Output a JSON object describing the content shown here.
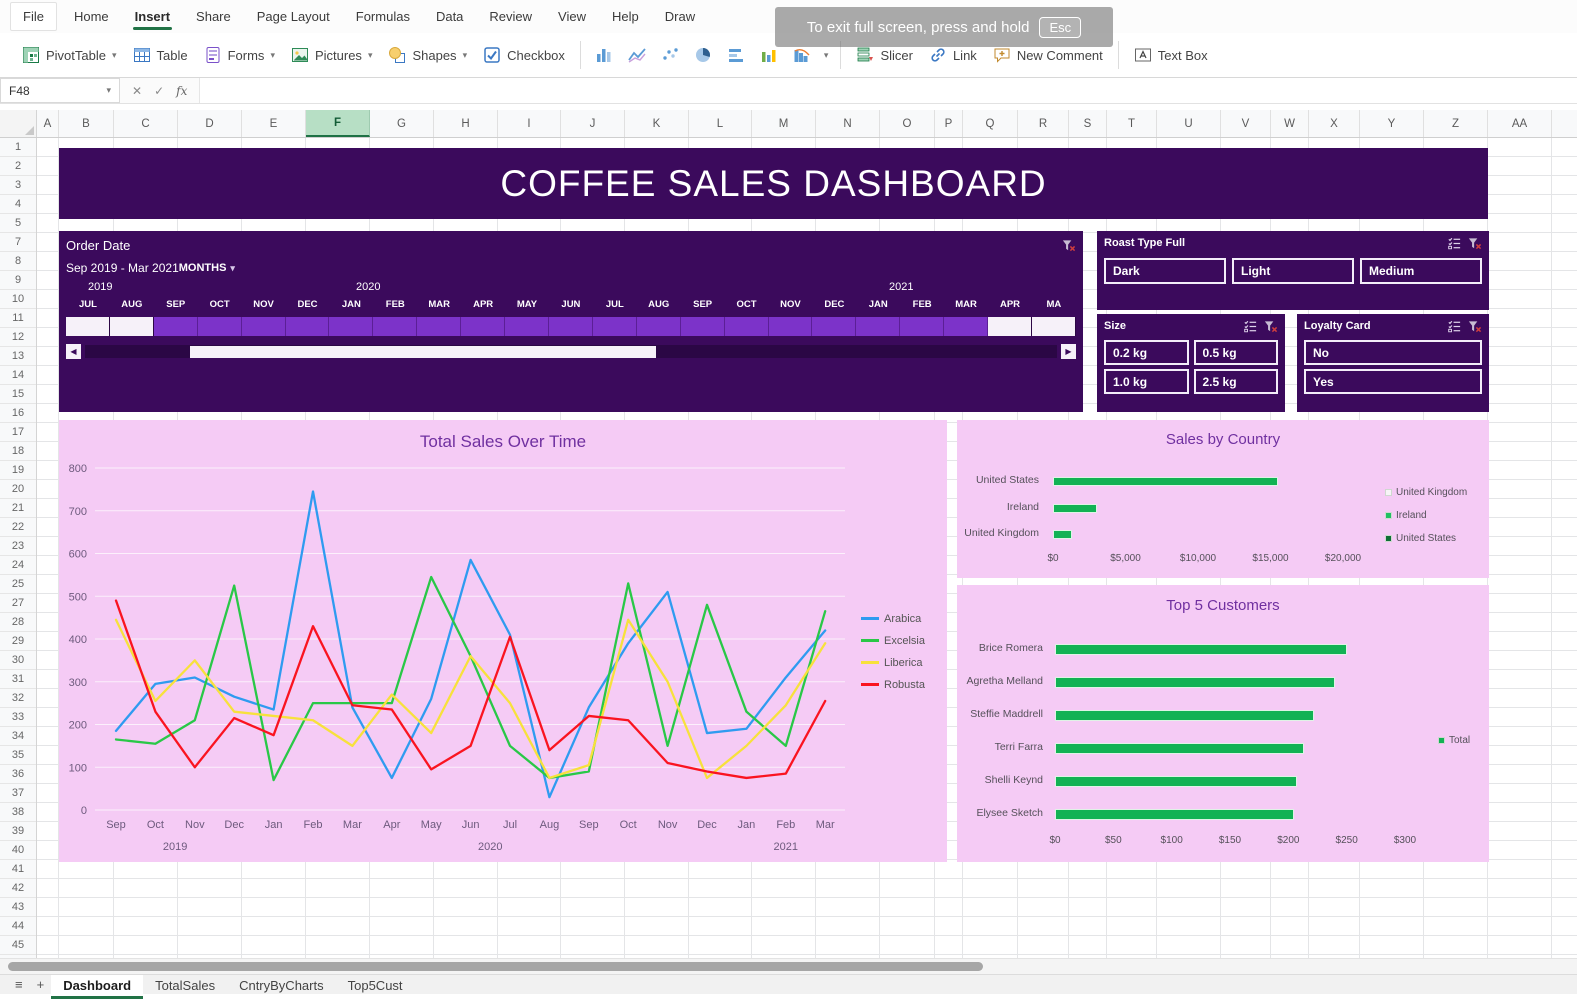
{
  "menu": {
    "tabs": [
      "File",
      "Home",
      "Insert",
      "Share",
      "Page Layout",
      "Formulas",
      "Data",
      "Review",
      "View",
      "Help",
      "Draw"
    ],
    "active": "Insert"
  },
  "overlay": {
    "text": "To exit full screen, press and hold",
    "key": "Esc"
  },
  "ribbon": {
    "items": [
      {
        "label": "PivotTable",
        "icon": "pivottable-icon",
        "caret": true
      },
      {
        "label": "Table",
        "icon": "table-icon",
        "caret": false
      },
      {
        "label": "Forms",
        "icon": "forms-icon",
        "caret": true
      },
      {
        "label": "Pictures",
        "icon": "pictures-icon",
        "caret": true
      },
      {
        "label": "Shapes",
        "icon": "shapes-icon",
        "caret": true
      },
      {
        "label": "Checkbox",
        "icon": "checkbox-icon",
        "caret": false
      }
    ],
    "chart_buttons": [
      "column-chart-icon",
      "line-chart-icon",
      "scatter-chart-icon",
      "pie-chart-icon",
      "bar-chart-icon",
      "column-chart2-icon",
      "histogram-chart-icon"
    ],
    "items2": [
      {
        "label": "Slicer",
        "icon": "slicer-icon",
        "caret": false
      },
      {
        "label": "Link",
        "icon": "link-icon",
        "caret": false
      },
      {
        "label": "New Comment",
        "icon": "comment-icon",
        "caret": false
      }
    ],
    "items3": [
      {
        "label": "Text Box",
        "icon": "textbox-icon",
        "caret": false
      }
    ]
  },
  "formula_bar": {
    "name_box": "F48",
    "cancel": "✕",
    "enter": "✓",
    "fx": "fx"
  },
  "grid": {
    "selected_column": "F",
    "columns": [
      {
        "label": "A",
        "width": 22
      },
      {
        "label": "B",
        "width": 55
      },
      {
        "label": "C",
        "width": 64
      },
      {
        "label": "D",
        "width": 64
      },
      {
        "label": "E",
        "width": 64
      },
      {
        "label": "F",
        "width": 64
      },
      {
        "label": "G",
        "width": 64
      },
      {
        "label": "H",
        "width": 64
      },
      {
        "label": "I",
        "width": 63
      },
      {
        "label": "J",
        "width": 64
      },
      {
        "label": "K",
        "width": 64
      },
      {
        "label": "L",
        "width": 63
      },
      {
        "label": "M",
        "width": 64
      },
      {
        "label": "N",
        "width": 64
      },
      {
        "label": "O",
        "width": 55
      },
      {
        "label": "P",
        "width": 28
      },
      {
        "label": "Q",
        "width": 55
      },
      {
        "label": "R",
        "width": 51
      },
      {
        "label": "S",
        "width": 38
      },
      {
        "label": "T",
        "width": 50
      },
      {
        "label": "U",
        "width": 64
      },
      {
        "label": "V",
        "width": 50
      },
      {
        "label": "W",
        "width": 38
      },
      {
        "label": "X",
        "width": 51
      },
      {
        "label": "Y",
        "width": 64
      },
      {
        "label": "Z",
        "width": 64
      },
      {
        "label": "AA",
        "width": 64
      }
    ],
    "rows": [
      1,
      2,
      3,
      4,
      5,
      7,
      8,
      9,
      10,
      11,
      12,
      13,
      14,
      15,
      16,
      17,
      18,
      19,
      20,
      21,
      22,
      23,
      24,
      25,
      27,
      28,
      29,
      30,
      31,
      32,
      33,
      34,
      35,
      36,
      37,
      38,
      39,
      40,
      41,
      42,
      43,
      44,
      45
    ]
  },
  "dashboard": {
    "title": "COFFEE SALES DASHBOARD",
    "timeline": {
      "title": "Order Date",
      "range_label": "Sep 2019 - Mar 2021",
      "period_label": "MONTHS",
      "years": [
        {
          "label": "2019"
        },
        {
          "label": "2020"
        },
        {
          "label": "2021"
        }
      ],
      "months": [
        {
          "label": "JUL",
          "selected": false
        },
        {
          "label": "AUG",
          "selected": false
        },
        {
          "label": "SEP",
          "selected": true
        },
        {
          "label": "OCT",
          "selected": true
        },
        {
          "label": "NOV",
          "selected": true
        },
        {
          "label": "DEC",
          "selected": true
        },
        {
          "label": "JAN",
          "selected": true
        },
        {
          "label": "FEB",
          "selected": true
        },
        {
          "label": "MAR",
          "selected": true
        },
        {
          "label": "APR",
          "selected": true
        },
        {
          "label": "MAY",
          "selected": true
        },
        {
          "label": "JUN",
          "selected": true
        },
        {
          "label": "JUL",
          "selected": true
        },
        {
          "label": "AUG",
          "selected": true
        },
        {
          "label": "SEP",
          "selected": true
        },
        {
          "label": "OCT",
          "selected": true
        },
        {
          "label": "NOV",
          "selected": true
        },
        {
          "label": "DEC",
          "selected": true
        },
        {
          "label": "JAN",
          "selected": true
        },
        {
          "label": "FEB",
          "selected": true
        },
        {
          "label": "MAR",
          "selected": true
        },
        {
          "label": "APR",
          "selected": false
        },
        {
          "label": "MA",
          "selected": false
        }
      ]
    },
    "slicers": [
      {
        "title": "Roast Type Full",
        "items": [
          "Dark",
          "Light",
          "Medium"
        ]
      },
      {
        "title": "Size",
        "items": [
          "0.2 kg",
          "0.5 kg",
          "1.0 kg",
          "2.5 kg"
        ]
      },
      {
        "title": "Loyalty Card",
        "items": [
          "No",
          "Yes"
        ]
      }
    ]
  },
  "chart_data": [
    {
      "type": "line",
      "title": "Total Sales Over Time",
      "categories": [
        "Sep",
        "Oct",
        "Nov",
        "Dec",
        "Jan",
        "Feb",
        "Mar",
        "Apr",
        "May",
        "Jun",
        "Jul",
        "Aug",
        "Sep",
        "Oct",
        "Nov",
        "Dec",
        "Jan",
        "Feb",
        "Mar"
      ],
      "year_groups": [
        {
          "label": "2019",
          "center_index": 1.5
        },
        {
          "label": "2020",
          "center_index": 9.5
        },
        {
          "label": "2021",
          "center_index": 17
        }
      ],
      "ylim": [
        0,
        800
      ],
      "ytick_step": 100,
      "legend_position": "right",
      "series": [
        {
          "name": "Arabica",
          "color": "#2f9bf0",
          "values": [
            185,
            295,
            310,
            265,
            235,
            745,
            240,
            75,
            260,
            585,
            410,
            30,
            240,
            390,
            510,
            180,
            190,
            310,
            420
          ]
        },
        {
          "name": "Excelsia",
          "color": "#29c847",
          "values": [
            165,
            155,
            210,
            525,
            70,
            250,
            250,
            250,
            545,
            360,
            150,
            75,
            90,
            530,
            150,
            480,
            230,
            150,
            465
          ]
        },
        {
          "name": "Liberica",
          "color": "#f7e13c",
          "values": [
            445,
            255,
            350,
            230,
            220,
            210,
            150,
            270,
            180,
            360,
            250,
            75,
            105,
            445,
            300,
            75,
            150,
            245,
            390
          ]
        },
        {
          "name": "Robusta",
          "color": "#fa1420",
          "values": [
            490,
            230,
            100,
            215,
            175,
            430,
            245,
            235,
            95,
            150,
            405,
            140,
            220,
            210,
            110,
            90,
            75,
            85,
            255
          ]
        }
      ]
    },
    {
      "type": "bar",
      "title": "Sales by Country",
      "categories": [
        "United States",
        "Ireland",
        "United Kingdom"
      ],
      "values": [
        15500,
        3000,
        1300
      ],
      "xlim": [
        0,
        20000
      ],
      "xticks": [
        "$0",
        "$5,000",
        "$10,000",
        "$15,000",
        "$20,000"
      ],
      "xtick_values": [
        0,
        5000,
        10000,
        15000,
        20000
      ],
      "bar_color": "#12b254",
      "legend": [
        {
          "label": "United Kingdom",
          "color": "#f7f4f7"
        },
        {
          "label": "Ireland",
          "color": "#21c063"
        },
        {
          "label": "United States",
          "color": "#0e6e35"
        }
      ]
    },
    {
      "type": "bar",
      "title": "Top 5 Customers",
      "categories": [
        "Brice Romera",
        "Agretha Melland",
        "Steffie Maddrell",
        "Terri Farra",
        "Shelli Keynd",
        "Elysee Sketch"
      ],
      "values": [
        250,
        240,
        222,
        213,
        207,
        205
      ],
      "xlim": [
        0,
        300
      ],
      "xticks": [
        "$0",
        "$50",
        "$100",
        "$150",
        "$200",
        "$250",
        "$300"
      ],
      "xtick_values": [
        0,
        50,
        100,
        150,
        200,
        250,
        300
      ],
      "bar_color": "#12b254",
      "legend": [
        {
          "label": "Total",
          "color": "#12b254"
        }
      ]
    }
  ],
  "sheet_tabs": {
    "active": "Dashboard",
    "tabs": [
      "Dashboard",
      "TotalSales",
      "CntryByCharts",
      "Top5Cust"
    ]
  }
}
